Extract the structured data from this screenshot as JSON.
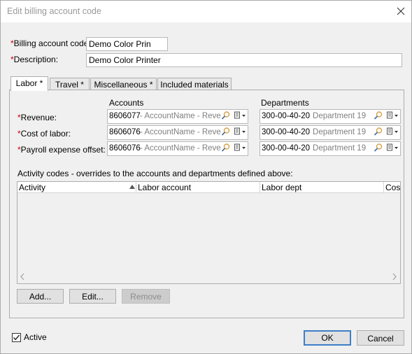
{
  "window": {
    "title": "Edit billing account code"
  },
  "form": {
    "billing_code": {
      "required_mark": "*",
      "label": "Billing account code",
      "value": "Demo Color Prin"
    },
    "description": {
      "required_mark": "*",
      "label": "Description:",
      "value": "Demo Color Printer"
    }
  },
  "tabs": [
    {
      "label": "Labor *",
      "active": true
    },
    {
      "label": "Travel *",
      "active": false
    },
    {
      "label": "Miscellaneous *",
      "active": false
    },
    {
      "label": "Included materials",
      "active": false
    }
  ],
  "labor": {
    "accounts_header": "Accounts",
    "departments_header": "Departments",
    "rows": [
      {
        "required_mark": "*",
        "label": "Revenue:",
        "account_code": "8606077",
        "account_name": " - AccountName - Reven",
        "dept_code": "300-00-40-20",
        "dept_name": " - Department 19"
      },
      {
        "required_mark": "*",
        "label": "Cost of labor:",
        "account_code": "8606076",
        "account_name": " - AccountName - Reven",
        "dept_code": "300-00-40-20",
        "dept_name": " - Department 19"
      },
      {
        "required_mark": "*",
        "label": "Payroll expense offset:",
        "account_code": "8606076",
        "account_name": " - AccountName - Reven",
        "dept_code": "300-00-40-20",
        "dept_name": " - Department 19"
      }
    ],
    "activity_caption": "Activity codes - overrides to the accounts and departments defined above:",
    "grid_columns": [
      "Activity",
      "Labor account",
      "Labor dept",
      "Cost"
    ],
    "buttons": {
      "add": "Add...",
      "edit": "Edit...",
      "remove": "Remove"
    }
  },
  "footer": {
    "active_label": "Active",
    "active_checked": true,
    "ok": "OK",
    "cancel": "Cancel"
  },
  "colors": {
    "required": "#cc0000",
    "accent": "#3c7fc7"
  }
}
